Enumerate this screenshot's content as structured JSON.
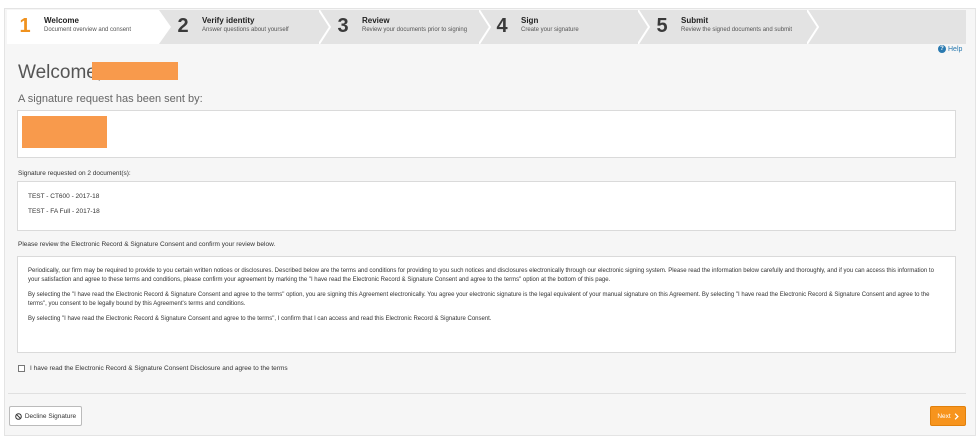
{
  "steps": [
    {
      "number": "1",
      "title": "Welcome",
      "subtitle": "Document overview and consent"
    },
    {
      "number": "2",
      "title": "Verify identity",
      "subtitle": "Answer questions about yourself"
    },
    {
      "number": "3",
      "title": "Review",
      "subtitle": "Review your documents prior to signing"
    },
    {
      "number": "4",
      "title": "Sign",
      "subtitle": "Create your signature"
    },
    {
      "number": "5",
      "title": "Submit",
      "subtitle": "Review the signed documents and submit"
    }
  ],
  "help_label": "Help",
  "welcome_text": "Welcome,",
  "sent_by_text": "A signature request has been sent by:",
  "documents_label": "Signature requested on 2 document(s):",
  "documents": [
    "TEST - CT600 - 2017-18",
    "TEST - FA Full - 2017-18"
  ],
  "review_label": "Please review the Electronic Record & Signature Consent and confirm your review below.",
  "consent_paragraphs": [
    "Periodically, our firm may be required to provide to you certain written notices or disclosures. Described below are the terms and conditions for providing to you such notices and disclosures electronically through our electronic signing system. Please read the information below carefully and thoroughly, and if you can access this information to your satisfaction and agree to these terms and conditions, please confirm your agreement by marking the \"I have read the Electronic Record & Signature Consent and agree to the terms\" option at the bottom of this page.",
    "By selecting the \"I have read the Electronic Record & Signature Consent and agree to the terms\" option, you are signing this Agreement electronically. You agree your electronic signature is the legal equivalent of your manual signature on this Agreement. By selecting \"I have read the Electronic Record & Signature Consent and agree to the terms\", you consent to be legally bound by this Agreement's terms and conditions.",
    "By selecting \"I have read the Electronic Record & Signature Consent and agree to the terms\", I confirm that I can access and read this Electronic Record & Signature Consent."
  ],
  "checkbox_label": "I have read the Electronic Record & Signature Consent Disclosure and agree to the terms",
  "decline_label": "Decline Signature",
  "next_label": "Next",
  "colors": {
    "accent": "#f7941d",
    "redaction": "#f89a4c",
    "link": "#2a7ab0"
  },
  "icons": {
    "help": "question-circle-icon",
    "decline": "ban-icon",
    "next": "chevron-right-icon"
  }
}
